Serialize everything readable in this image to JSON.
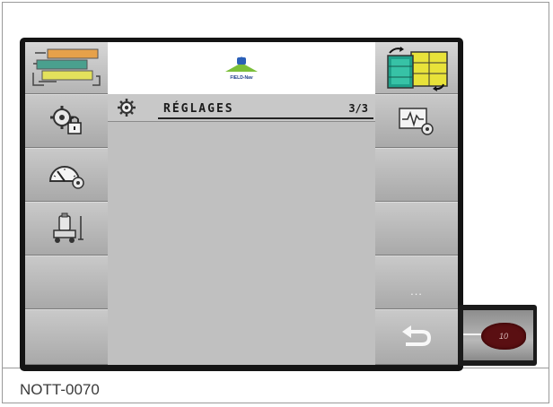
{
  "caption": "NOTT-0070",
  "header": {
    "logo_text": "FIELD-Nav"
  },
  "settings_panel": {
    "title": "RÉGLAGES",
    "page": "3/3"
  },
  "left_buttons": [
    {
      "icon": "field-map-lines-icon"
    },
    {
      "icon": "gear-lock-icon"
    },
    {
      "icon": "speedometer-gear-icon"
    },
    {
      "icon": "sprayer-scale-icon"
    },
    {
      "icon": ""
    },
    {
      "icon": ""
    }
  ],
  "right_buttons": [
    {
      "icon": "swap-view-icon"
    },
    {
      "icon": "diagnostics-gear-icon"
    },
    {
      "icon": ""
    },
    {
      "icon": ""
    },
    {
      "icon": "more-icon",
      "label": "..."
    },
    {
      "icon": "return-arrow-icon"
    }
  ],
  "side_device": {
    "label": "10"
  },
  "colors": {
    "bezel": "#141414",
    "panel_gray": "#c0c0c0",
    "swap_yellow": "#e8e23a",
    "swap_teal": "#1fa08a"
  }
}
